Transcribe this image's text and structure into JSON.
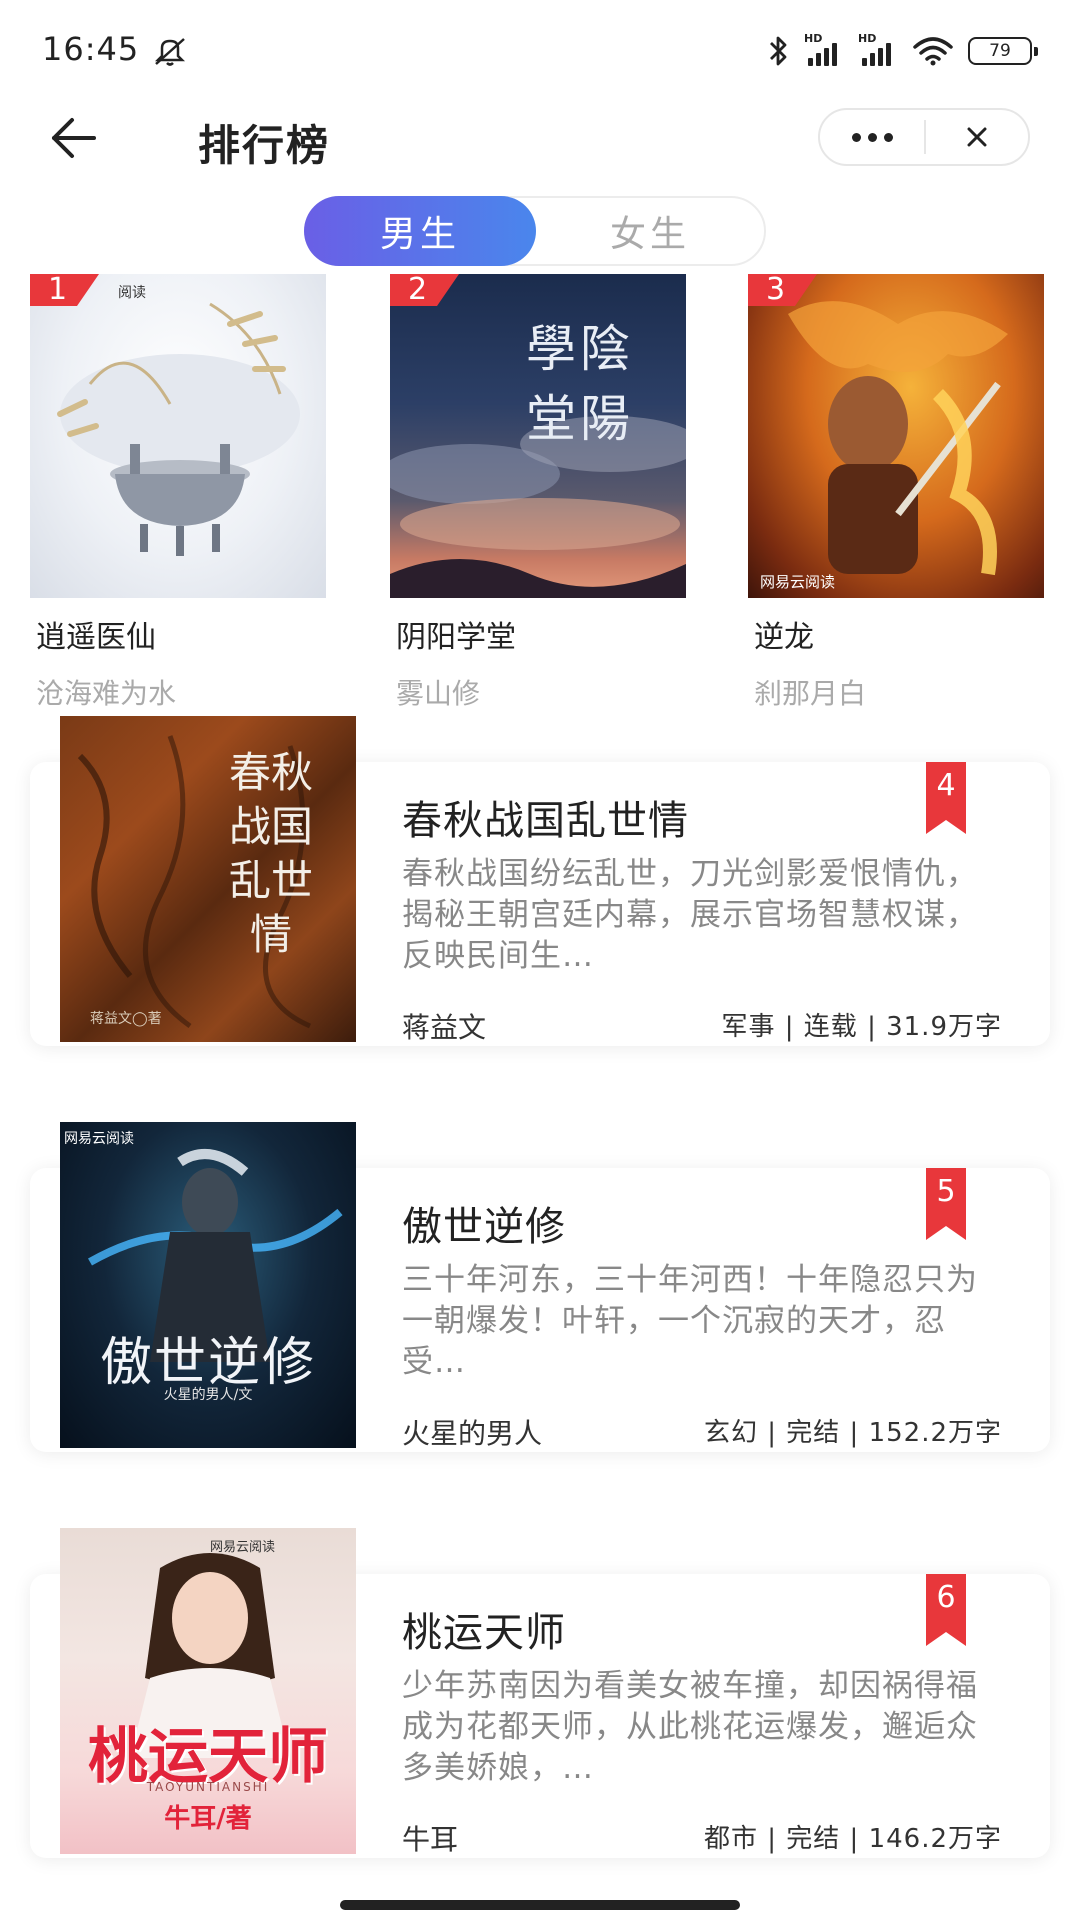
{
  "status_bar": {
    "time": "16:45",
    "battery": "79",
    "icons": [
      "bell-off-icon",
      "bluetooth-icon",
      "signal-hd-icon",
      "signal-hd-icon",
      "wifi-icon",
      "battery-icon"
    ]
  },
  "header": {
    "title": "排行榜",
    "back_icon": "arrow-left-icon",
    "more_icon": "more-dots-icon",
    "close_icon": "close-icon"
  },
  "tabs": [
    {
      "label": "男生",
      "active": true
    },
    {
      "label": "女生",
      "active": false
    }
  ],
  "top3": [
    {
      "rank": "1",
      "title": "逍遥医仙",
      "author": "沧海难为水",
      "cover_tag": "阅读"
    },
    {
      "rank": "2",
      "title": "阴阳学堂",
      "author": "雾山修",
      "cover_tag": "學陰 堂陽"
    },
    {
      "rank": "3",
      "title": "逆龙",
      "author": "刹那月白",
      "cover_tag": "网易云阅读"
    }
  ],
  "list": [
    {
      "rank": "4",
      "title": "春秋战国乱世情",
      "description": "春秋战国纷纭乱世，刀光剑影爱恨情仇，揭秘王朝宫廷内幕，展示官场智慧权谋，反映民间生…",
      "author": "蒋益文",
      "meta": "军事 | 连载 | 31.9万字",
      "cover_text": "春秋战国 乱世情",
      "cover_author": "蒋益文◯著"
    },
    {
      "rank": "5",
      "title": "傲世逆修",
      "description": "三十年河东，三十年河西！十年隐忍只为一朝爆发！叶轩，一个沉寂的天才，忍受…",
      "author": "火星的男人",
      "meta": "玄幻 | 完结 | 152.2万字",
      "cover_text": "傲世逆修",
      "cover_author": "火星的男人/文",
      "cover_tag": "网易云阅读"
    },
    {
      "rank": "6",
      "title": "桃运天师",
      "description": "少年苏南因为看美女被车撞，却因祸得福成为花都天师，从此桃花运爆发，邂逅众多美娇娘，…",
      "author": "牛耳",
      "meta": "都市 | 完结 | 146.2万字",
      "cover_text": "桃运天师",
      "cover_sub": "TAOYUNTIANSHI",
      "cover_author": "牛耳/著",
      "cover_tag": "网易云阅读"
    }
  ],
  "colors": {
    "accent_start": "#6a5fe6",
    "accent_end": "#4a86ec",
    "rank_red": "#e8373b"
  }
}
